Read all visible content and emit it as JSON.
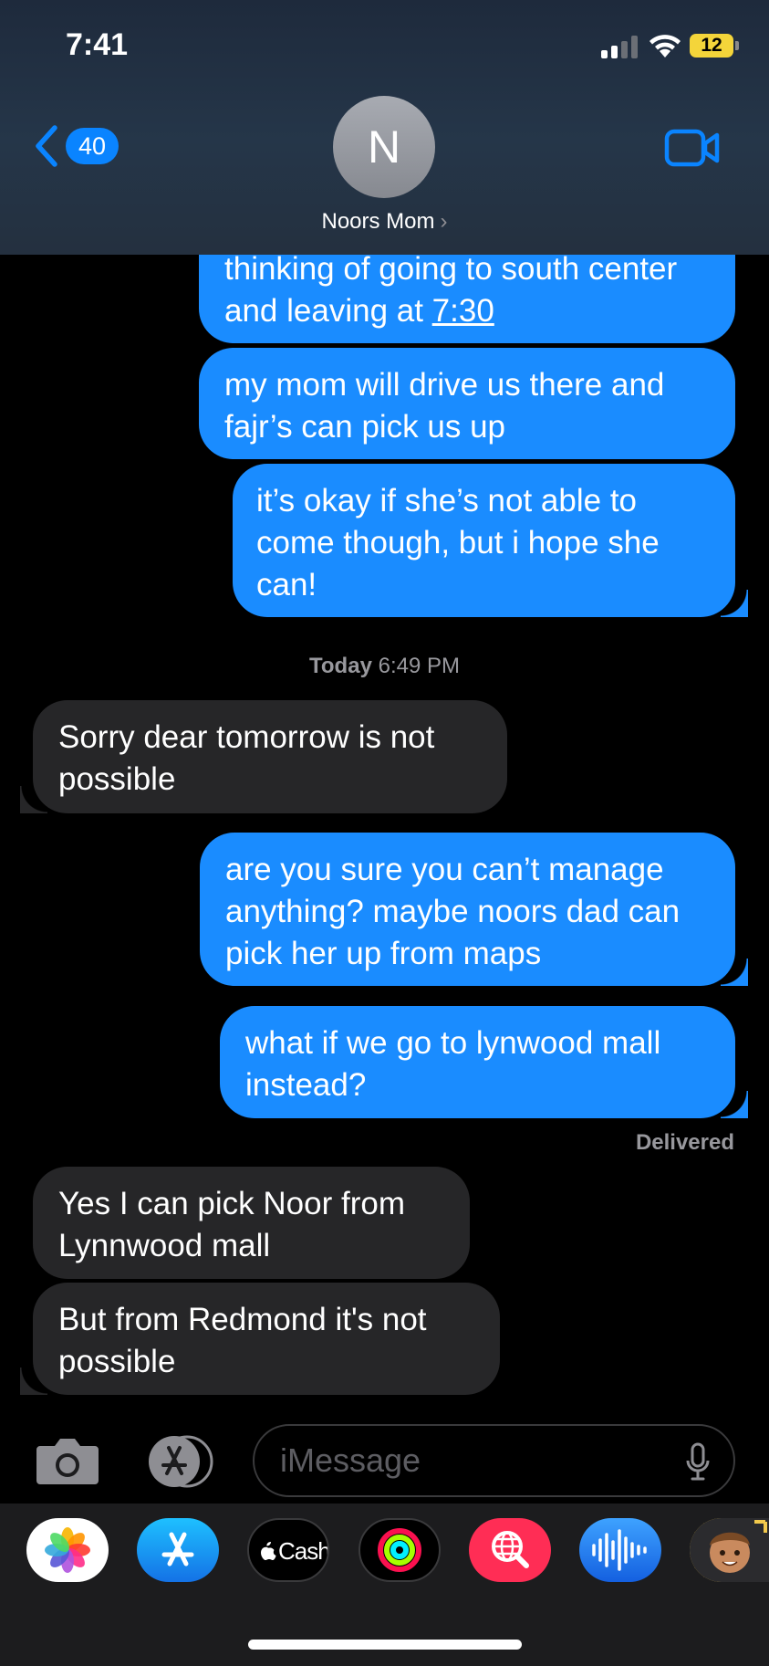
{
  "status_bar": {
    "time": "7:41",
    "battery": "12"
  },
  "header": {
    "back_count": "40",
    "avatar_initial": "N",
    "contact_name": "Noors Mom",
    "contact_chevron": "›"
  },
  "messages": [
    {
      "type": "sent",
      "text_a": "thinking of going to south center and leaving at ",
      "text_link": "7:30"
    },
    {
      "type": "sent",
      "text": "my mom will drive us there and fajr’s can pick us up"
    },
    {
      "type": "sent",
      "text": "it’s okay if she’s not able to come though, but i hope she can!"
    },
    {
      "type": "received",
      "text": "Sorry dear tomorrow is not possible"
    },
    {
      "type": "sent",
      "text": "are you sure you can’t manage anything? maybe noors dad can pick her up from maps"
    },
    {
      "type": "sent",
      "text": "what if we go to lynwood mall instead?"
    },
    {
      "type": "received",
      "text": "Yes I can pick Noor from Lynnwood mall"
    },
    {
      "type": "received",
      "text": "But from Redmond it's not possible"
    }
  ],
  "timestamp": {
    "day": "Today",
    "time": "6:49 PM"
  },
  "delivered_label": "Delivered",
  "input": {
    "placeholder": "iMessage"
  },
  "apps": [
    {
      "name": "photos-app",
      "icon": "photos-icon"
    },
    {
      "name": "app-store",
      "icon": "app-store-icon"
    },
    {
      "name": "apple-cash",
      "label": "Cash",
      "icon": "apple-cash-icon"
    },
    {
      "name": "activity",
      "icon": "activity-rings-icon"
    },
    {
      "name": "image-search",
      "icon": "globe-search-icon"
    },
    {
      "name": "audio-message",
      "icon": "waveform-icon"
    },
    {
      "name": "memoji",
      "icon": "memoji-icon"
    }
  ],
  "colors": {
    "sent_bubble": "#1a8cff",
    "received_bubble": "#262628",
    "accent": "#0a84ff",
    "battery": "#f4d53a"
  }
}
